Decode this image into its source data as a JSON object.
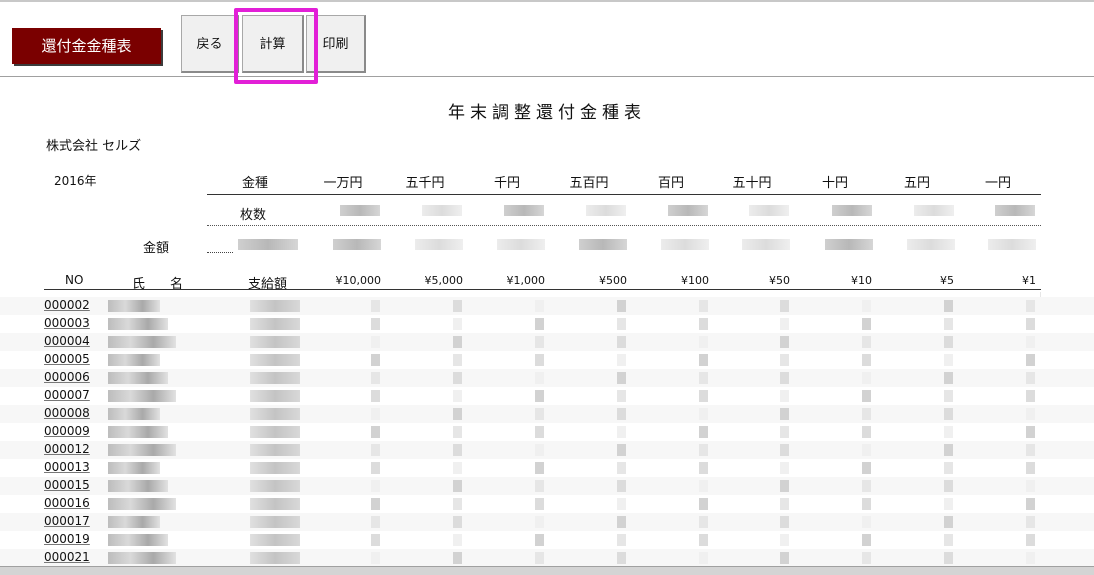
{
  "toolbar": {
    "sheet_title": "還付金金種表",
    "back_label": "戻る",
    "calc_label": "計算",
    "print_label": "印刷"
  },
  "document": {
    "title": "年末調整還付金種表",
    "company": "株式会社 セルズ",
    "year": "2016年",
    "denomination_header": "金種",
    "count_label": "枚数",
    "amount_label": "金額",
    "denominations": [
      "一万円",
      "五千円",
      "千円",
      "五百円",
      "百円",
      "五十円",
      "十円",
      "五円",
      "一円"
    ],
    "column_headers": {
      "no": "NO",
      "family_name": "氏",
      "given_name": "名",
      "payment": "支給額",
      "values": [
        "¥10,000",
        "¥5,000",
        "¥1,000",
        "¥500",
        "¥100",
        "¥50",
        "¥10",
        "¥5",
        "¥1"
      ]
    },
    "employee_numbers": [
      "000002",
      "000003",
      "000004",
      "000005",
      "000006",
      "000007",
      "000008",
      "000009",
      "000012",
      "000013",
      "000015",
      "000016",
      "000017",
      "000019",
      "000021"
    ]
  },
  "colors": {
    "badge": "#7a0000",
    "highlight": "#e21fd7"
  }
}
